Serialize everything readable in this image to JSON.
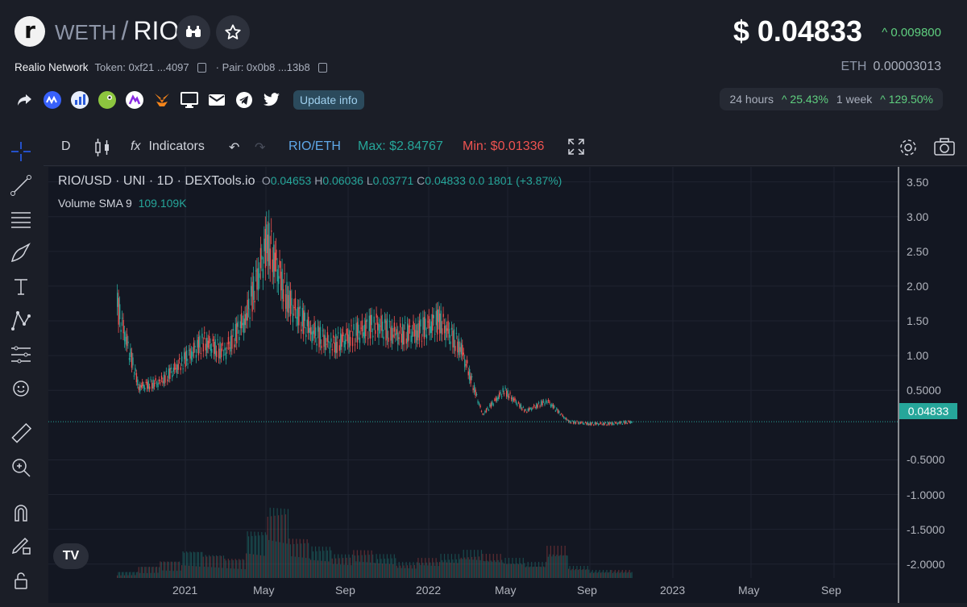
{
  "header": {
    "logo_letter": "r",
    "base_symbol": "WETH",
    "separator": "/",
    "quote_symbol": "RIO",
    "project_name": "Realio Network",
    "token_label": "Token: 0xf21 ...4097",
    "pair_label": "· Pair: 0x0b8 ...13b8",
    "update_label": "Update info",
    "price": "$ 0.04833",
    "price_change": "^ 0.009800",
    "eth_label": "ETH",
    "eth_value": "0.00003013",
    "stats": {
      "period1": "24 hours",
      "change1": "^ 25.43%",
      "period2": "1 week",
      "change2": "^ 129.50%"
    }
  },
  "toolbar": {
    "interval": "D",
    "indicators_label": "Indicators",
    "pair_toggle": "RIO/ETH",
    "max_label": "Max: $2.84767",
    "min_label": "Min: $0.01336"
  },
  "legend": {
    "title": "RIO/USD · UNI · 1D · DEXTools.io",
    "o_key": "O",
    "o": "0.04653",
    "h_key": "H",
    "h": "0.06036",
    "l_key": "L",
    "l": "0.03771",
    "c_key": "C",
    "c": "0.04833",
    "chg": "0.0 1801 (+3.87%)",
    "volume_label": "Volume SMA 9",
    "volume_value": "109.109K"
  },
  "colors": {
    "up": "#26a69a",
    "down": "#ef5350",
    "accent_green": "#5fcf7f",
    "max_color": "#26a69a",
    "min_color": "#ef5350"
  },
  "chart_data": {
    "type": "line",
    "title": "RIO/USD · UNI · 1D · DEXTools.io",
    "y_ticks": [
      "3.50",
      "3.00",
      "2.50",
      "2.00",
      "1.50",
      "1.00",
      "0.5000",
      "-0.5000",
      "-1.0000",
      "-1.5000",
      "-2.0000"
    ],
    "x_ticks": [
      "2021",
      "May",
      "Sep",
      "2022",
      "May",
      "Sep",
      "2023",
      "May",
      "Sep"
    ],
    "current_price_label": "0.04833",
    "ylim": [
      -2.2,
      3.6
    ],
    "series": [
      {
        "x": [
          "2020-11",
          "2020-11",
          "2020-12",
          "2021-01",
          "2021-02",
          "2021-03",
          "2021-04",
          "2021-05",
          "2021-05",
          "2021-06",
          "2021-07",
          "2021-08",
          "2021-09",
          "2021-10",
          "2021-11",
          "2021-12",
          "2022-01",
          "2022-02",
          "2022-03",
          "2022-04",
          "2022-05",
          "2022-06",
          "2022-08",
          "2022-10",
          "2022-11"
        ],
        "values": [
          1.7,
          0.55,
          0.62,
          0.9,
          1.2,
          1.05,
          1.55,
          2.65,
          1.75,
          1.35,
          1.15,
          1.3,
          1.45,
          1.3,
          1.35,
          1.5,
          1.1,
          0.15,
          0.5,
          0.2,
          0.35,
          0.05,
          0.02,
          0.02,
          0.05
        ]
      }
    ],
    "volume_values": [
      0.08,
      0.15,
      0.22,
      0.35,
      0.3,
      0.25,
      0.6,
      0.9,
      0.5,
      0.4,
      0.3,
      0.35,
      0.3,
      0.2,
      0.25,
      0.3,
      0.35,
      0.3,
      0.25,
      0.2,
      0.4,
      0.15,
      0.1,
      0.1,
      0.45
    ]
  }
}
